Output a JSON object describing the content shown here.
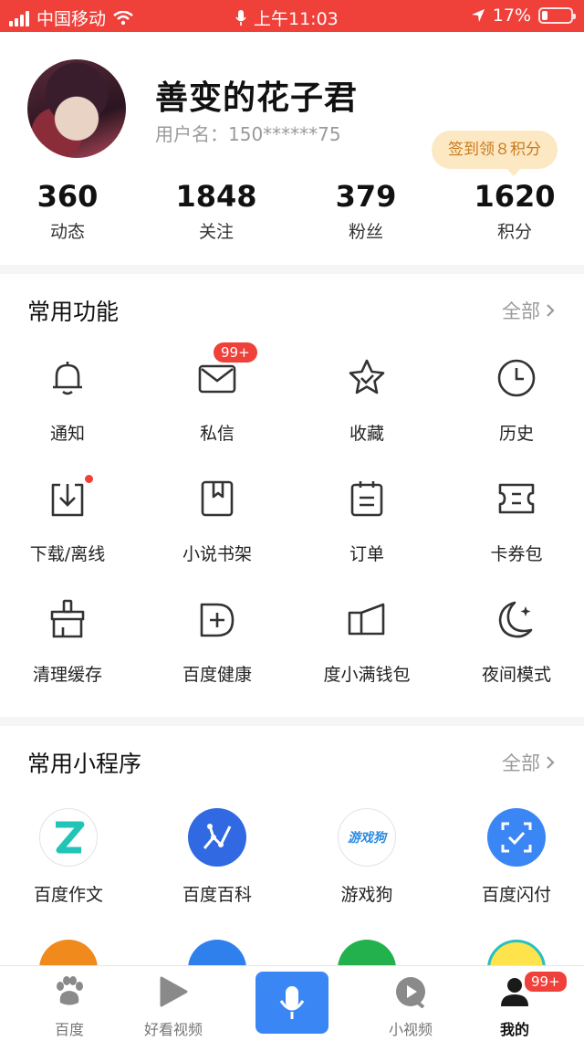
{
  "status_bar": {
    "carrier": "中国移动",
    "time": "上午11:03",
    "battery": "17%"
  },
  "profile": {
    "nickname": "善变的花子君",
    "username": "用户名：150******75",
    "signin_tip": "签到领８积分",
    "stats": [
      {
        "value": "360",
        "label": "动态"
      },
      {
        "value": "1848",
        "label": "关注"
      },
      {
        "value": "379",
        "label": "粉丝"
      },
      {
        "value": "1620",
        "label": "积分"
      }
    ]
  },
  "common_functions": {
    "title": "常用功能",
    "more": "全部",
    "items": [
      {
        "label": "通知",
        "icon": "bell-icon"
      },
      {
        "label": "私信",
        "icon": "mail-icon",
        "badge": "99+"
      },
      {
        "label": "收藏",
        "icon": "star-icon"
      },
      {
        "label": "历史",
        "icon": "clock-icon"
      },
      {
        "label": "下载/离线",
        "icon": "download-icon"
      },
      {
        "label": "小说书架",
        "icon": "book-icon"
      },
      {
        "label": "订单",
        "icon": "order-icon"
      },
      {
        "label": "卡券包",
        "icon": "ticket-icon"
      },
      {
        "label": "清理缓存",
        "icon": "broom-icon"
      },
      {
        "label": "百度健康",
        "icon": "health-icon"
      },
      {
        "label": "度小满钱包",
        "icon": "wallet-icon"
      },
      {
        "label": "夜间模式",
        "icon": "moon-icon"
      }
    ]
  },
  "mini_programs": {
    "title": "常用小程序",
    "more": "全部",
    "items": [
      {
        "label": "百度作文",
        "icon": "zuowen-icon"
      },
      {
        "label": "百度百科",
        "icon": "baike-icon"
      },
      {
        "label": "游戏狗",
        "icon": "youxigou-icon",
        "logo_text": "游戏狗"
      },
      {
        "label": "百度闪付",
        "icon": "shanfu-icon"
      }
    ]
  },
  "tabbar": {
    "items": [
      {
        "label": "百度",
        "icon": "baidu-paw-icon"
      },
      {
        "label": "好看视频",
        "icon": "play-icon"
      },
      {
        "label": "",
        "icon": "microphone-icon"
      },
      {
        "label": "小视频",
        "icon": "small-video-icon"
      },
      {
        "label": "我的",
        "icon": "user-icon",
        "badge": "99+"
      }
    ]
  }
}
